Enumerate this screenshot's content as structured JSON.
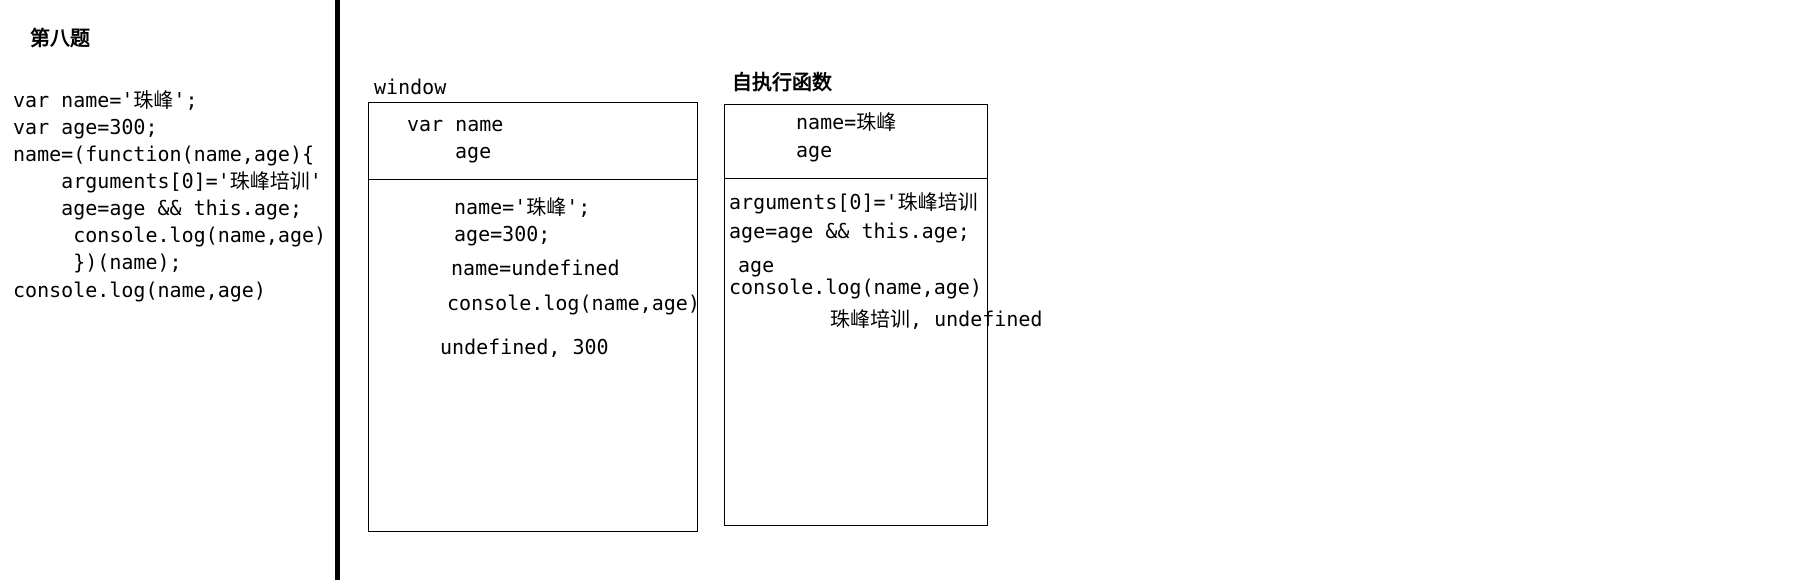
{
  "title": "第八题",
  "code": {
    "lines": [
      "var name='珠峰';",
      "var age=300;",
      "name=(function(name,age){",
      "    arguments[0]='珠峰培训'",
      "    age=age && this.age;",
      "     console.log(name,age)",
      "     })(name);",
      "console.log(name,age)"
    ]
  },
  "window_scope": {
    "label": "window",
    "vars_line1": "var name",
    "vars_line2": "age",
    "exec": {
      "line1": "name='珠峰';",
      "line2": "age=300;",
      "line3": "name=undefined",
      "line4": "console.log(name,age)",
      "line5": "undefined, 300"
    }
  },
  "function_scope": {
    "label": "自执行函数",
    "vars_line1": "name=珠峰",
    "vars_line2": "age",
    "exec": {
      "line1": "arguments[0]='珠峰培训",
      "line2": "age=age && this.age;",
      "line3": "age",
      "line4": "console.log(name,age)",
      "line5": "珠峰培训, undefined"
    }
  }
}
